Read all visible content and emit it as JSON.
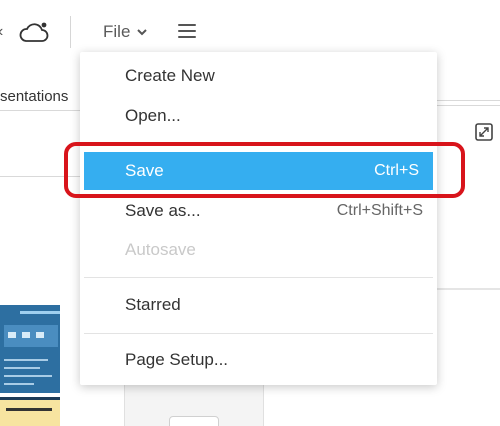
{
  "toolbar": {
    "file_label": "File",
    "icons": [
      "cloud-sync-icon",
      "chevron-down-icon",
      "hamburger-menu-icon"
    ]
  },
  "sidebar": {
    "tab_label": "sentations"
  },
  "file_menu": {
    "items": [
      {
        "label": "Create New",
        "shortcut": "",
        "state": "normal"
      },
      {
        "label": "Open...",
        "shortcut": "",
        "state": "normal"
      },
      {
        "label": "Save",
        "shortcut": "Ctrl+S",
        "state": "selected"
      },
      {
        "label": "Save as...",
        "shortcut": "Ctrl+Shift+S",
        "state": "normal"
      },
      {
        "label": "Autosave",
        "shortcut": "",
        "state": "disabled"
      },
      {
        "label": "Starred",
        "shortcut": "",
        "state": "normal"
      },
      {
        "label": "Page Setup...",
        "shortcut": "",
        "state": "normal"
      }
    ]
  },
  "colors": {
    "selection": "#35aef0",
    "highlight": "#d8141b",
    "disabled_text": "#c9c9c9"
  }
}
